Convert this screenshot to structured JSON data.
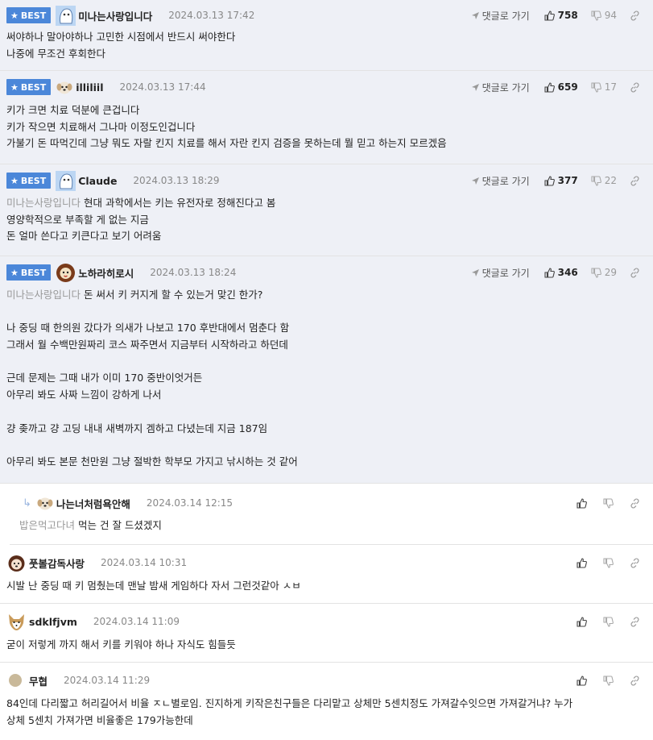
{
  "labels": {
    "best": "BEST",
    "reply_link": "댓글로 가기"
  },
  "colors": {
    "best_badge": "#4b87d9",
    "best_bg": "#eef0f6",
    "mention": "#999999"
  },
  "comments": [
    {
      "nick": "미나는사랑입니다",
      "date": "2024.03.13 17:42",
      "up": "758",
      "down": "94",
      "avatar": "ghost-avatar",
      "lines": [
        "써야하나 말아야하나 고민한 시점에서 반드시 써야한다",
        "나중에 무조건 후회한다"
      ]
    },
    {
      "nick": "illiliil",
      "date": "2024.03.13 17:44",
      "up": "659",
      "down": "17",
      "avatar": "puppy-avatar",
      "lines": [
        "키가 크면 치료 덕분에 큰겁니다",
        "키가 작으면 치료해서 그나마 이정도인겁니다",
        "가불기 돈 따먹긴데 그냥 뭐도 자랄 킨지 치료를 해서 자란 킨지 검증을 못하는데 뭘 믿고 하는지 모르겠음"
      ]
    },
    {
      "nick": "Claude",
      "date": "2024.03.13 18:29",
      "up": "377",
      "down": "22",
      "avatar": "ghost-avatar",
      "mention": "미나는사랑입니다",
      "lines": [
        "현대 과학에서는 키는 유전자로 정해진다고 봄",
        "영양학적으로 부족할 게 없는 지금",
        "돈 얼마 쓴다고 키큰다고 보기 어려움"
      ]
    },
    {
      "nick": "노하라히로시",
      "date": "2024.03.13 18:24",
      "up": "346",
      "down": "29",
      "avatar": "lion-avatar",
      "mention": "미나는사랑입니다",
      "lines": [
        "돈 써서 키 커지게 할 수 있는거 맞긴 한가?",
        "",
        "나 중딩 때 한의원 갔다가 의새가 나보고 170 후반대에서 멈춘다 함",
        "그래서 월 수백만원짜리 코스 짜주면서 지금부터 시작하라고 하던데",
        "",
        "근데 문제는 그때 내가 이미 170 중반이엇거든",
        "아무리 봐도 사짜 느낌이 강하게 나서",
        "",
        "걍 좆까고 걍 고딩 내내 새벽까지 겜하고 다녔는데 지금 187임",
        "",
        "아무리 봐도 본문 천만원 그냥 절박한 학부모 가지고 낚시하는 것 같어"
      ]
    }
  ],
  "reply": {
    "nick": "나는너처럼욕안해",
    "date": "2024.03.14 12:15",
    "mention": "밥은먹고다녀",
    "text": "먹는 건 잘 드셨겠지"
  },
  "normal": [
    {
      "nick": "풋볼감독사랑",
      "date": "2024.03.14 10:31",
      "avatar": "dog-avatar",
      "lines": [
        "시발 난 중딩 때 키 멈췄는데 맨날 밤새 게임하다 자서 그런것같아 ㅅㅂ"
      ]
    },
    {
      "nick": "sdklfjvm",
      "date": "2024.03.14 11:09",
      "avatar": "fox-avatar",
      "lines": [
        "굳이 저렇게 까지 해서 키를 키워야 하나 자식도 힘들듯"
      ]
    },
    {
      "nick": "무협",
      "date": "2024.03.14 11:29",
      "avatar": "dot-avatar",
      "lines": [
        "84인데 다리짧고 허리길어서 비율 ㅈㄴ별로임. 진지하게 키작은친구들은 다리맡고 상체만 5센치정도 가져갈수잇으면 가져갈거냐? 누가",
        "상체 5센치 가져가면 비율좋은 179가능한데"
      ]
    }
  ]
}
